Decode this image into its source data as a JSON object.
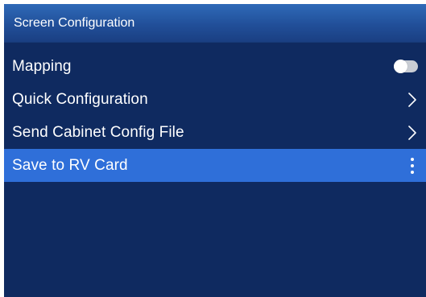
{
  "header": {
    "title": "Screen Configuration"
  },
  "menu": {
    "items": [
      {
        "label": "Mapping",
        "control": "toggle",
        "toggle_on": false
      },
      {
        "label": "Quick Configuration",
        "control": "chevron-right-icon"
      },
      {
        "label": "Send Cabinet Config File",
        "control": "chevron-right-icon"
      },
      {
        "label": "Save to RV Card",
        "control": "more-vertical-icon",
        "selected": true
      }
    ]
  },
  "colors": {
    "panel_background": "#0f2a60",
    "title_bar": "#2a5ea8",
    "selected_row": "#2f6fd9",
    "text": "#ffffff",
    "toggle_off": "#c9cdd4"
  }
}
